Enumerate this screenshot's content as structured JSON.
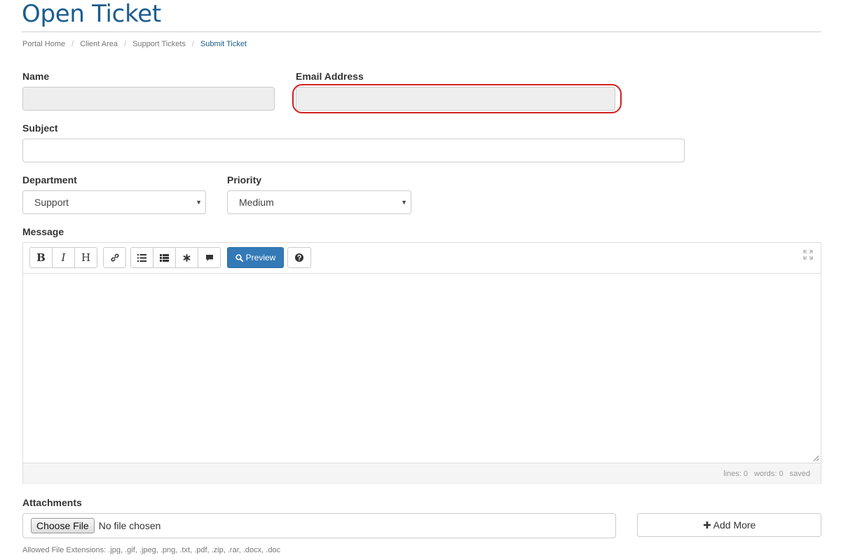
{
  "page": {
    "title": "Open Ticket"
  },
  "breadcrumb": [
    {
      "label": "Portal Home"
    },
    {
      "label": "Client Area"
    },
    {
      "label": "Support Tickets"
    },
    {
      "label": "Submit Ticket"
    }
  ],
  "form": {
    "name": {
      "label": "Name",
      "value": ""
    },
    "email": {
      "label": "Email Address",
      "value": ""
    },
    "subject": {
      "label": "Subject",
      "value": ""
    },
    "department": {
      "label": "Department",
      "selected": "Support"
    },
    "priority": {
      "label": "Priority",
      "selected": "Medium"
    },
    "message": {
      "label": "Message",
      "value": ""
    }
  },
  "editor": {
    "toolbar": {
      "bold": "B",
      "italic": "I",
      "heading": "H",
      "preview_label": "Preview"
    },
    "status": {
      "lines": "lines: 0",
      "words": "words: 0",
      "saved": "saved"
    }
  },
  "attachments": {
    "label": "Attachments",
    "choose_label": "Choose File",
    "no_file_text": "No file chosen",
    "add_more_label": "Add More",
    "allowed_text": "Allowed File Extensions: .jpg, .gif, .jpeg, .png, .txt, .pdf, .zip, .rar, .docx, .doc"
  },
  "colors": {
    "title": "#1b5d8e",
    "primary_button": "#337ab7",
    "highlight": "#d41f1f"
  }
}
